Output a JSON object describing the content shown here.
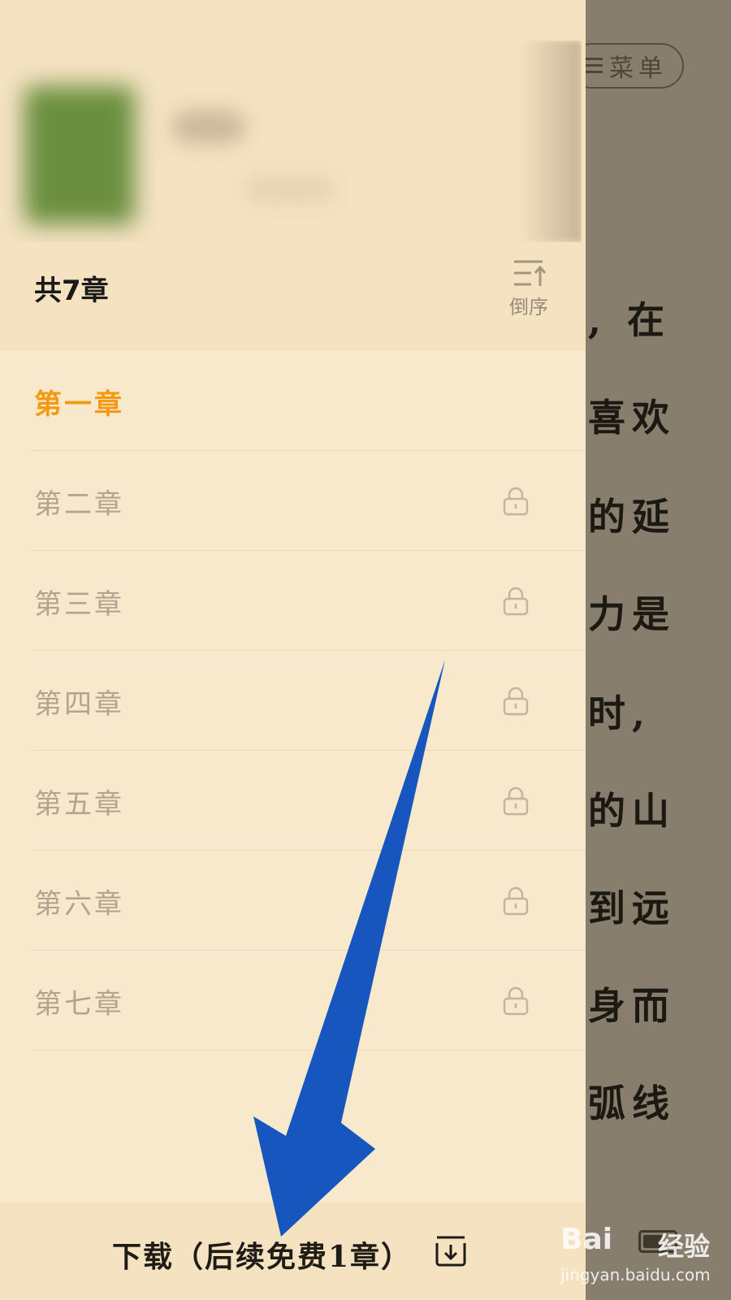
{
  "reader": {
    "menu_label": "菜单",
    "lines": [
      ", 在",
      "喜欢",
      "的延",
      "力是",
      "时,",
      "的山",
      "到远",
      "身而",
      "弧线"
    ]
  },
  "drawer": {
    "total_chapters": "共7章",
    "sort_label": "倒序",
    "chapters": [
      {
        "title": "第一章",
        "locked": false,
        "current": true
      },
      {
        "title": "第二章",
        "locked": true,
        "current": false
      },
      {
        "title": "第三章",
        "locked": true,
        "current": false
      },
      {
        "title": "第四章",
        "locked": true,
        "current": false
      },
      {
        "title": "第五章",
        "locked": true,
        "current": false
      },
      {
        "title": "第六章",
        "locked": true,
        "current": false
      },
      {
        "title": "第七章",
        "locked": true,
        "current": false
      }
    ],
    "download_label": "下载（后续免费1章）"
  },
  "watermark": {
    "logo": "Bai",
    "text": "经验",
    "url": "jingyan.baidu.com"
  },
  "colors": {
    "drawer_bg": "#f8e9cd",
    "header_bg": "#f4e2c1",
    "active_chapter": "#f39a13",
    "inactive_chapter": "#b2a58f",
    "overlay": "#877e6d",
    "annotation_arrow": "#1656be"
  }
}
